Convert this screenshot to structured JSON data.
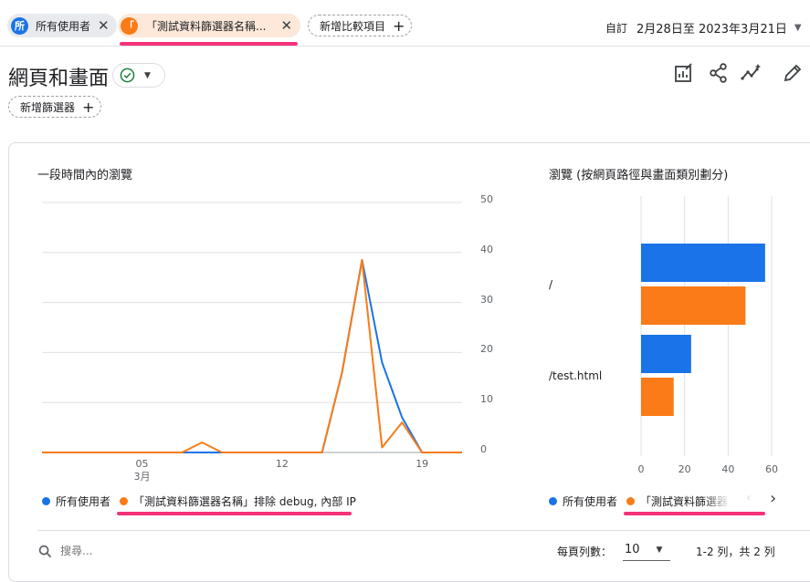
{
  "colors": {
    "blue": "#1a73e8",
    "orange": "#fa7b17",
    "highlight": "#f5327a"
  },
  "compare": {
    "chip1": {
      "avatar": "所",
      "label": "所有使用者"
    },
    "chip2": {
      "avatar": "「",
      "label": "「測試資料篩選器名稱..."
    },
    "add_label": "新增比較項目"
  },
  "date_range": {
    "prefix": "自訂",
    "range": "2月28日至 2023年3月21日"
  },
  "page": {
    "title": "網頁和畫面",
    "filter_button": "新增篩選器"
  },
  "line_chart_title": "一段時間內的瀏覽",
  "bar_chart_title": "瀏覽 (按網頁路徑與畫面類別劃分)",
  "legend": {
    "all_users": "所有使用者",
    "test_filter": "「測試資料篩選器名稱」排除 debug, 內部 IP",
    "test_filter_short": "「測試資料篩選器"
  },
  "table": {
    "search_placeholder": "搜尋...",
    "rows_label": "每頁列數：",
    "rows_value": "10",
    "pagination": "1-2 列，共 2 列"
  },
  "chart_data": [
    {
      "type": "line",
      "title": "一段時間內的瀏覽",
      "x_ticks": [
        "05\n3月",
        "12",
        "19"
      ],
      "x": [
        "02-28",
        "03-01",
        "03-02",
        "03-03",
        "03-04",
        "03-05",
        "03-06",
        "03-07",
        "03-08",
        "03-09",
        "03-10",
        "03-11",
        "03-12",
        "03-13",
        "03-14",
        "03-15",
        "03-16",
        "03-17",
        "03-18",
        "03-19",
        "03-20",
        "03-21"
      ],
      "ylim": [
        0,
        50
      ],
      "y_ticks": [
        0,
        10,
        20,
        30,
        40,
        50
      ],
      "grid": true,
      "series": [
        {
          "name": "所有使用者",
          "color": "#1a73e8",
          "values": [
            0,
            0,
            0,
            0,
            0,
            0,
            0,
            0,
            0,
            0,
            0,
            0,
            0,
            0,
            0,
            16,
            38.5,
            18,
            7,
            0,
            0,
            0
          ]
        },
        {
          "name": "「測試資料篩選器名稱」排除 debug, 內部 IP",
          "color": "#fa7b17",
          "values": [
            0,
            0,
            0,
            0,
            0,
            0,
            0,
            0,
            2,
            0,
            0,
            0,
            0,
            0,
            0,
            16,
            38.5,
            1,
            6,
            0,
            0,
            0
          ]
        }
      ]
    },
    {
      "type": "bar",
      "title": "瀏覽 (按網頁路徑與畫面類別劃分)",
      "orientation": "horizontal",
      "categories": [
        "/",
        "/test.html"
      ],
      "xlim": [
        0,
        60
      ],
      "x_ticks": [
        0,
        20,
        40,
        60
      ],
      "series": [
        {
          "name": "所有使用者",
          "color": "#1a73e8",
          "values": [
            57,
            23
          ]
        },
        {
          "name": "「測試資料篩選器名稱」排除 debug, 內部 IP",
          "color": "#fa7b17",
          "values": [
            48,
            15
          ]
        }
      ]
    }
  ]
}
